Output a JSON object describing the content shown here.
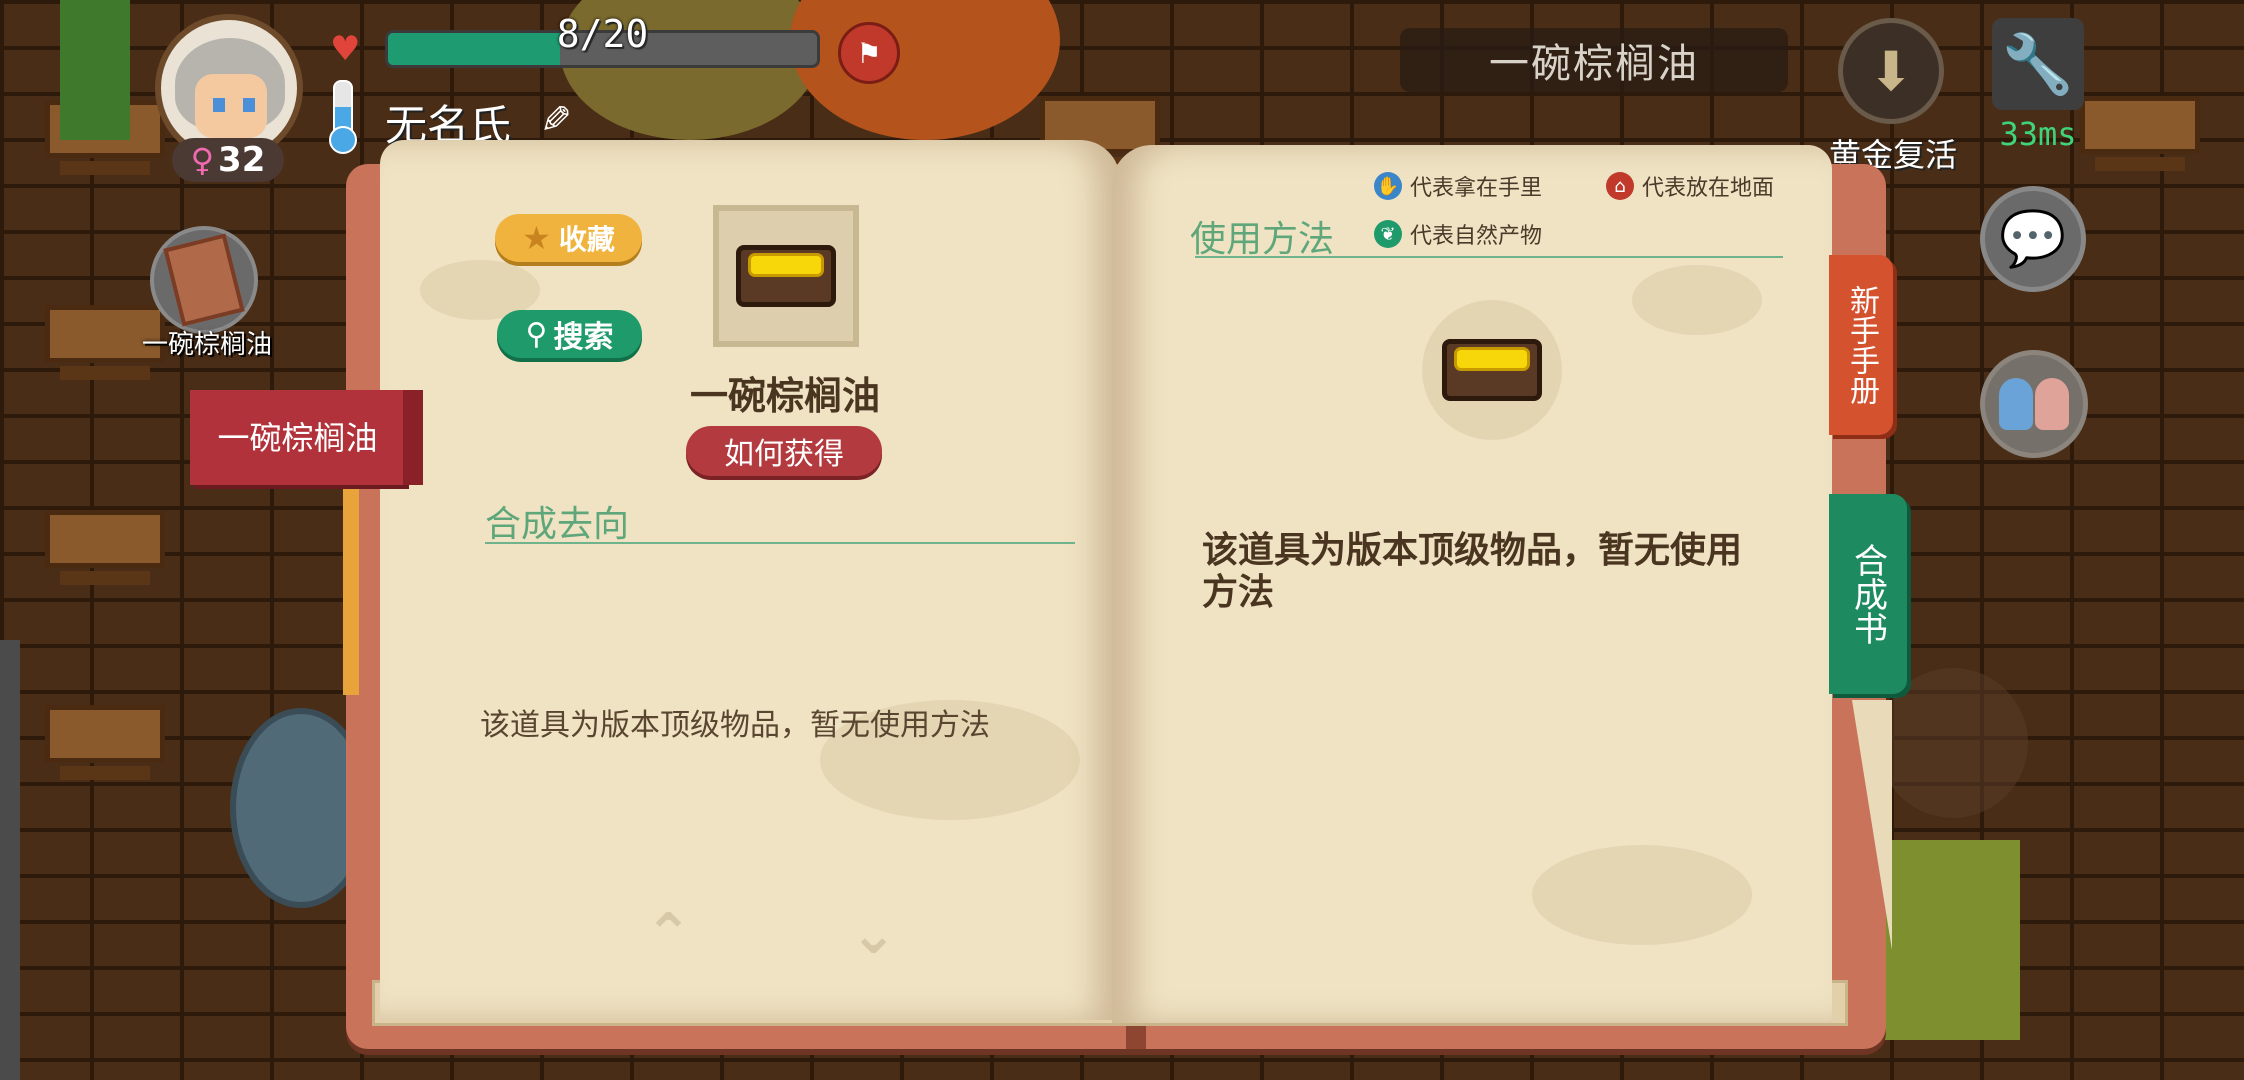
{
  "hud": {
    "hp_current": 8,
    "hp_max": 20,
    "hp_text": "8/20",
    "player_name": "无名氏",
    "level": "32",
    "gender_symbol": "♀",
    "item_title": "一碗棕榈油",
    "revive_label": "黄金复活",
    "ping": "33ms",
    "held_item_label": "一碗棕榈油"
  },
  "book": {
    "bookmark_label": "一碗棕榈油",
    "favorite_label": "收藏",
    "search_label": "搜索",
    "item_name": "一碗棕榈油",
    "how_to_get_label": "如何获得",
    "left_section_title": "合成去向",
    "left_description": "该道具为版本顶级物品，暂无使用方法",
    "right_section_title": "使用方法",
    "legend": {
      "hand": "代表拿在手里",
      "ground": "代表放在地面",
      "nature": "代表自然产物"
    },
    "right_description": "该道具为版本顶级物品，暂无使用方法",
    "tab_newbie": "新手手册",
    "tab_craft": "合成书"
  },
  "colors": {
    "hp_fill": "#1e9b70",
    "accent_green": "#1f9a6b",
    "accent_red": "#b33a3e",
    "page": "#efe3c4"
  }
}
